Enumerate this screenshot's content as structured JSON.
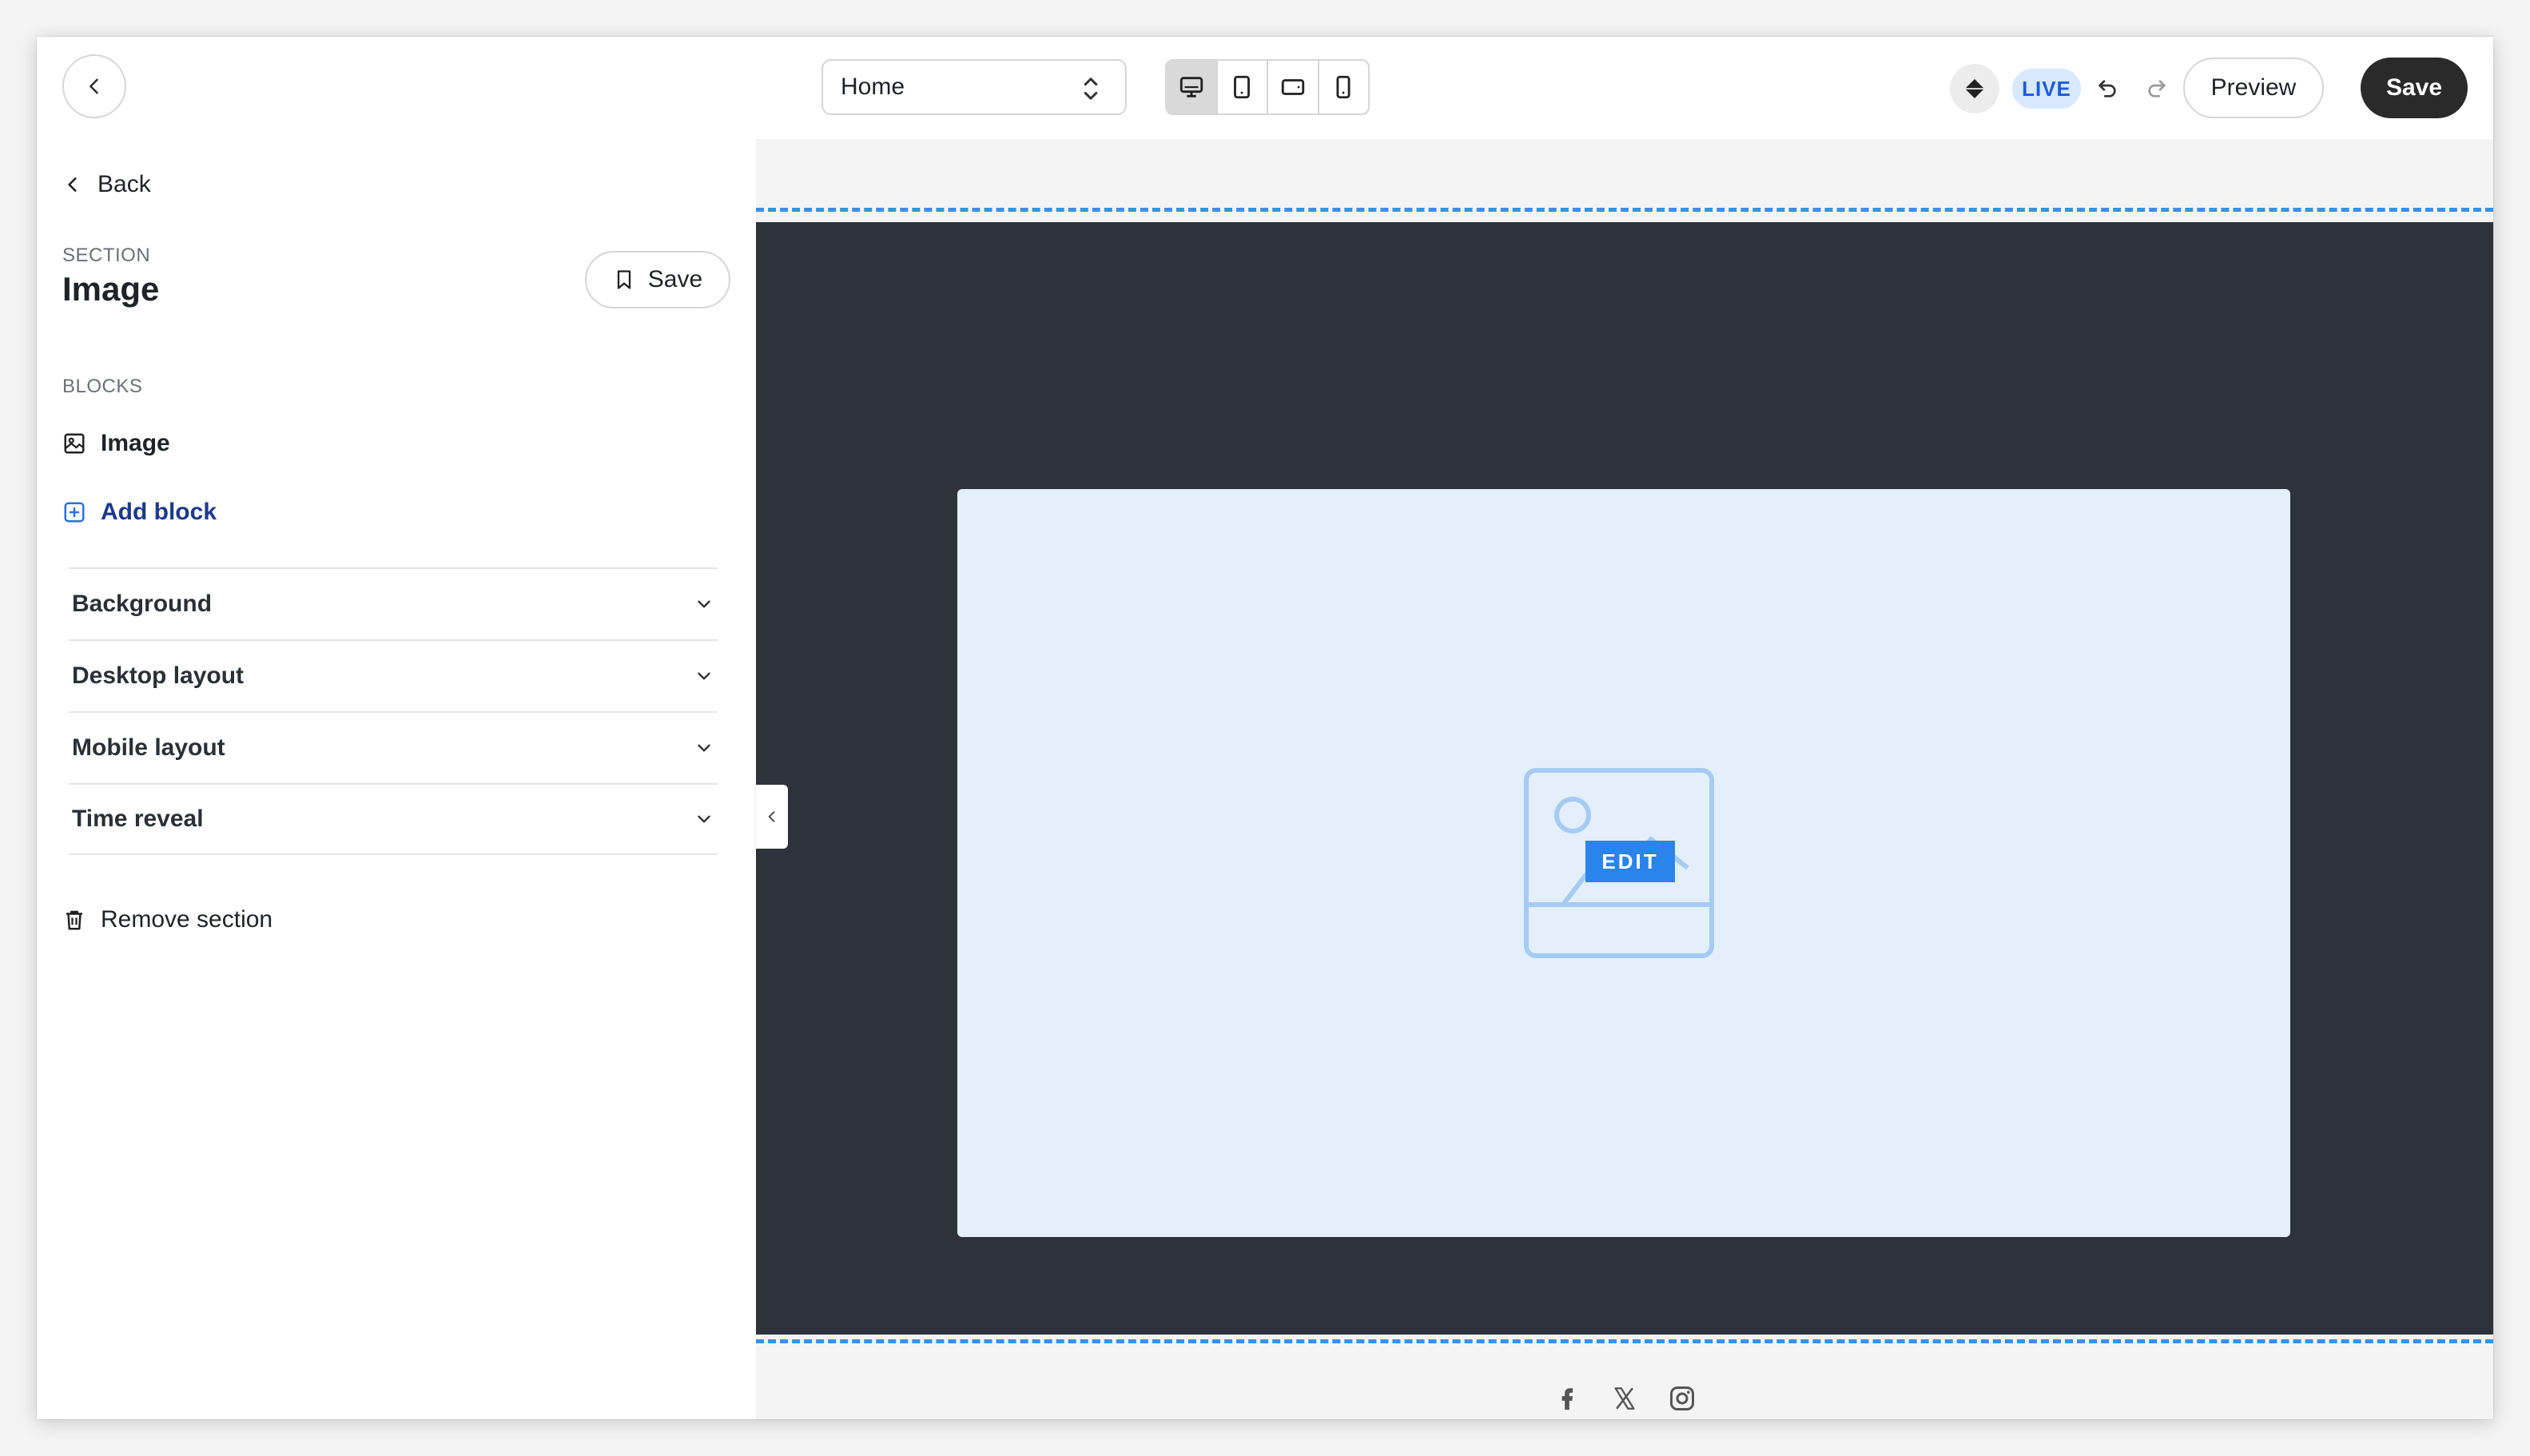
{
  "topbar": {
    "page_select": "Home",
    "live_badge": "LIVE",
    "preview_label": "Preview",
    "save_label": "Save",
    "devices": [
      "desktop-icon",
      "tablet-icon",
      "tablet-landscape-icon",
      "mobile-icon"
    ],
    "active_device": "desktop"
  },
  "sidebar": {
    "back_label": "Back",
    "section_label": "SECTION",
    "section_title": "Image",
    "save_label": "Save",
    "blocks_label": "BLOCKS",
    "block_item": "Image",
    "add_block": "Add block",
    "accordion": [
      "Background",
      "Desktop layout",
      "Mobile layout",
      "Time reveal"
    ],
    "remove_section": "Remove section"
  },
  "canvas": {
    "edit_badge": "EDIT",
    "social_icons": [
      "facebook-icon",
      "x-icon",
      "instagram-icon"
    ]
  },
  "colors": {
    "accent": "#3b8fe5",
    "dark_section": "#2e323a",
    "image_panel": "#e3effb",
    "save_button": "#2a2a2a",
    "live_badge_bg": "#d8e8ff",
    "live_badge_text": "#1e5bd6",
    "add_block_text": "#1d3a8a"
  }
}
